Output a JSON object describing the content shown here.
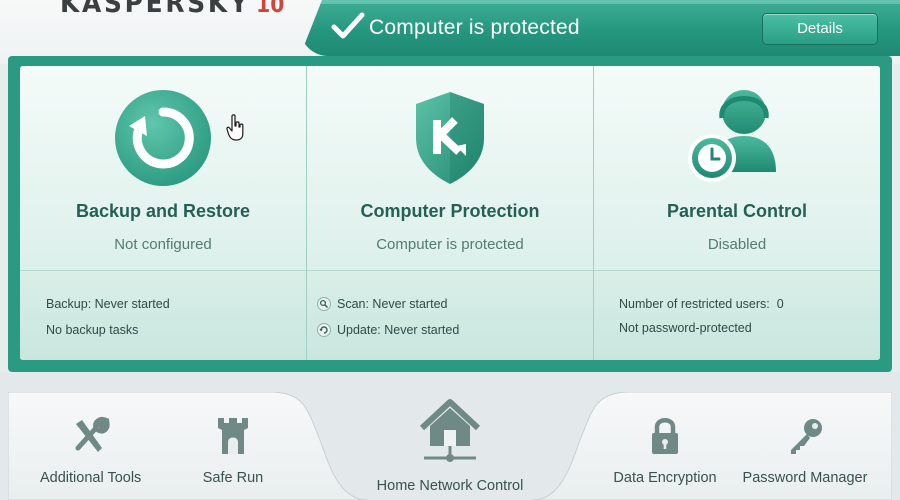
{
  "app": {
    "logo_text": "KASPERSKY",
    "logo_version": "10"
  },
  "status": {
    "text": "Computer is protected",
    "details_label": "Details"
  },
  "tiles": [
    {
      "title": "Backup and Restore",
      "subtitle": "Not configured",
      "icon": "backup-restore-icon",
      "lines": [
        "Backup: Never started",
        "No backup tasks"
      ]
    },
    {
      "title": "Computer Protection",
      "subtitle": "Computer is protected",
      "icon": "kaspersky-shield-icon",
      "lines": [
        "Scan: Never started",
        "Update: Never started"
      ]
    },
    {
      "title": "Parental Control",
      "subtitle": "Disabled",
      "icon": "parental-control-icon",
      "lines": [
        "Number of restricted users:  0",
        "Not password-protected"
      ]
    }
  ],
  "tools": [
    {
      "label": "Additional Tools",
      "icon": "tools-icon"
    },
    {
      "label": "Safe Run",
      "icon": "safe-run-tower-icon"
    },
    {
      "label": "Home Network Control",
      "icon": "home-network-icon"
    },
    {
      "label": "Data Encryption",
      "icon": "lock-icon"
    },
    {
      "label": "Password Manager",
      "icon": "key-icon"
    }
  ],
  "colors": {
    "accent": "#24957d",
    "tile_title": "#265f55",
    "panel_bg": "#2a9a82"
  }
}
